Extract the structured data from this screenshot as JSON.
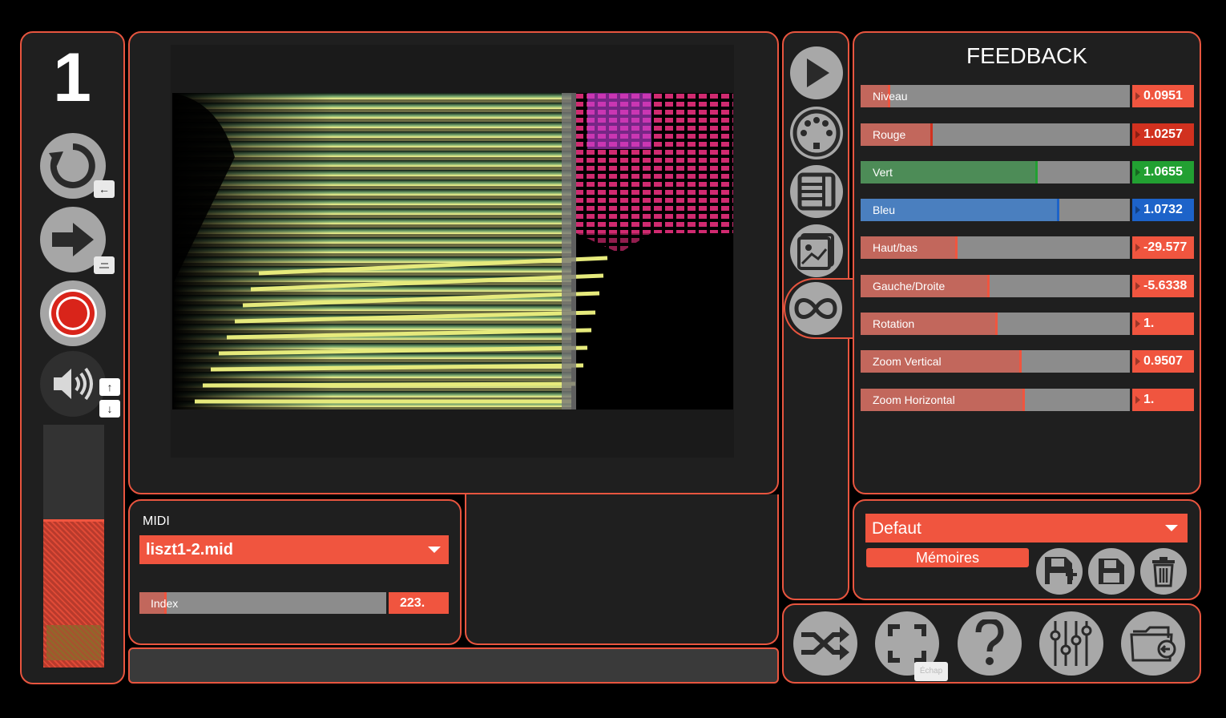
{
  "track": {
    "number": "1"
  },
  "left_controls": {
    "loop_hint": "←",
    "volume_up": "↑",
    "volume_down": "↓"
  },
  "feedback": {
    "title": "FEEDBACK",
    "params": [
      {
        "label": "Niveau",
        "value": "0.0951",
        "level": 0.1,
        "fill": "#c2675c",
        "box": "#f0553f"
      },
      {
        "label": "Rouge",
        "value": "1.0257",
        "level": 0.26,
        "fill": "#c2675c",
        "box": "#d1311f"
      },
      {
        "label": "Vert",
        "value": "1.0655",
        "level": 0.65,
        "fill": "#4d8c57",
        "box": "#22a032"
      },
      {
        "label": "Bleu",
        "value": "1.0732",
        "level": 0.73,
        "fill": "#4a7fbf",
        "box": "#1d63c9"
      },
      {
        "label": "Haut/bas",
        "value": "-29.577",
        "level": 0.35,
        "fill": "#c2675c",
        "box": "#f0553f"
      },
      {
        "label": "Gauche/Droite",
        "value": "-5.6338",
        "level": 0.47,
        "fill": "#c2675c",
        "box": "#f0553f"
      },
      {
        "label": "Rotation",
        "value": "1.",
        "level": 0.5,
        "fill": "#c2675c",
        "box": "#f0553f"
      },
      {
        "label": "Zoom Vertical",
        "value": "0.9507",
        "level": 0.59,
        "fill": "#c2675c",
        "box": "#f0553f"
      },
      {
        "label": "Zoom Horizontal",
        "value": "1.",
        "level": 0.6,
        "fill": "#c2675c",
        "box": "#f0553f"
      }
    ]
  },
  "midi": {
    "heading": "MIDI",
    "file": "liszt1-2.mid",
    "index_label": "Index",
    "index_value": "223.",
    "index_level": 0.1
  },
  "memories": {
    "preset": "Defaut",
    "button_label": "Mémoires"
  },
  "bottom": {
    "fullscreen_tooltip": "Échap"
  },
  "icons": [
    "loop-icon",
    "arrow-right-icon",
    "record-icon",
    "speaker-icon",
    "play-icon",
    "midi-icon",
    "piano-icon",
    "image-icon",
    "infinity-icon",
    "shuffle-icon",
    "fullscreen-icon",
    "help-icon",
    "mixer-icon",
    "folder-icon",
    "save-add-icon",
    "save-icon",
    "trash-icon"
  ],
  "colors": {
    "accent": "#f0553f",
    "panel": "#1f1f1f",
    "button": "#a8a8a8"
  }
}
